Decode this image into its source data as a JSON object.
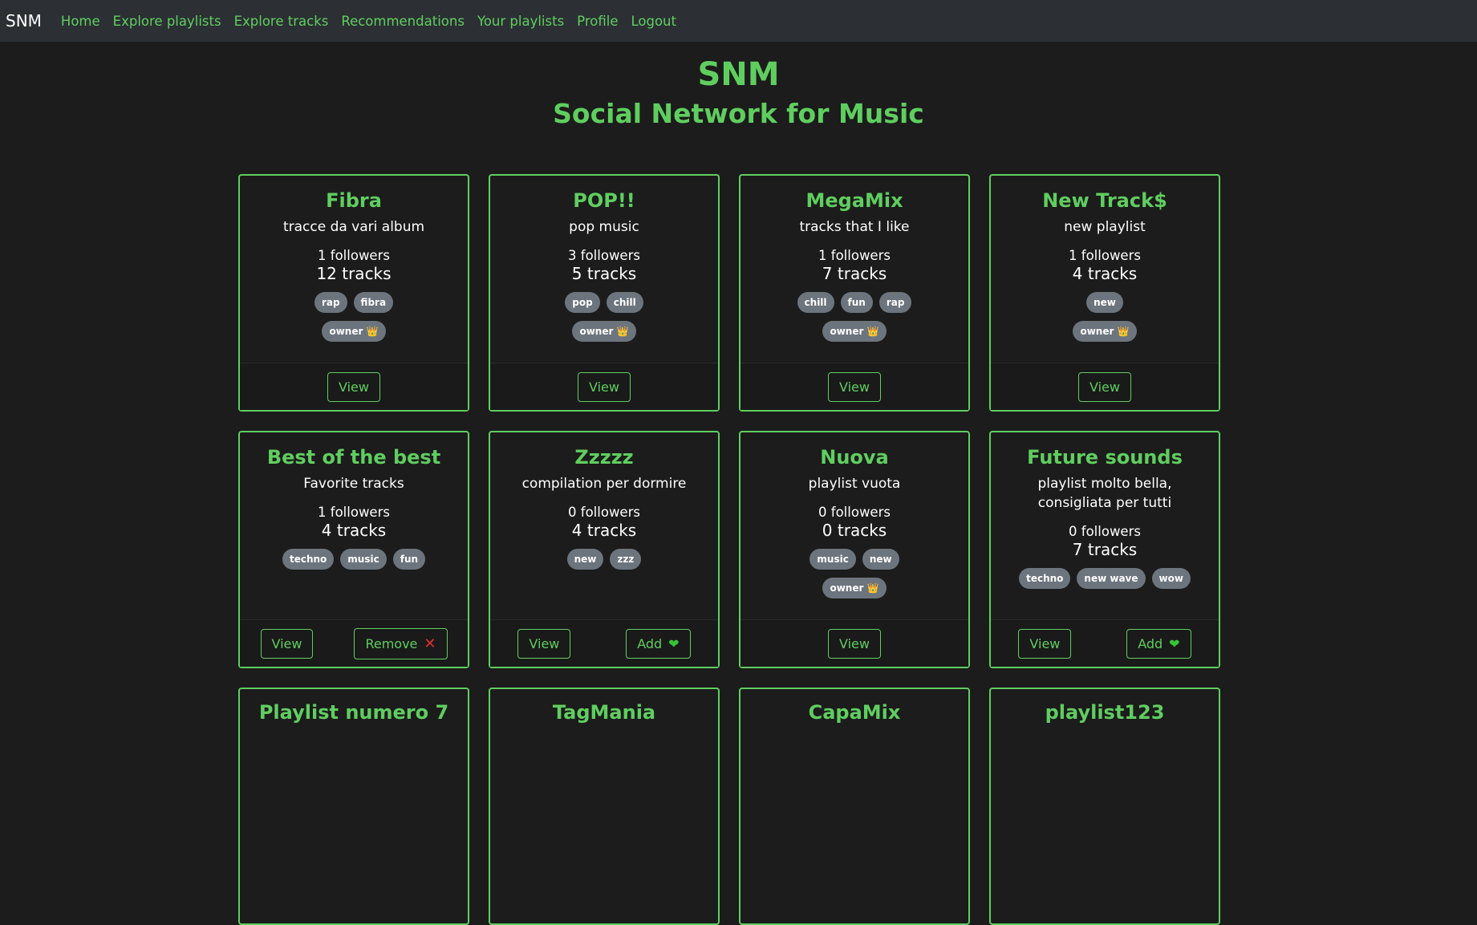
{
  "nav": {
    "brand": "SNM",
    "links": [
      "Home",
      "Explore playlists",
      "Explore tracks",
      "Recommendations",
      "Your playlists",
      "Profile",
      "Logout"
    ]
  },
  "hero": {
    "title": "SNM",
    "subtitle": "Social Network for Music"
  },
  "labels": {
    "view": "View",
    "add": "Add",
    "remove": "Remove",
    "owner": "owner 👑"
  },
  "playlists": [
    {
      "title": "Fibra",
      "description": "tracce da vari album",
      "followers": "1 followers",
      "tracks": "12 tracks",
      "tags": [
        "rap",
        "fibra"
      ]
    },
    {
      "title": "POP!!",
      "description": "pop music",
      "followers": "3 followers",
      "tracks": "5 tracks",
      "tags": [
        "pop",
        "chill"
      ]
    },
    {
      "title": "MegaMix",
      "description": "tracks that I like",
      "followers": "1 followers",
      "tracks": "7 tracks",
      "tags": [
        "chill",
        "fun",
        "rap"
      ]
    },
    {
      "title": "New Track$",
      "description": "new playlist",
      "followers": "1 followers",
      "tracks": "4 tracks",
      "tags": [
        "new"
      ]
    },
    {
      "title": "Best of the best",
      "description": "Favorite tracks",
      "followers": "1 followers",
      "tracks": "4 tracks",
      "tags": [
        "techno",
        "music",
        "fun"
      ]
    },
    {
      "title": "Zzzzz",
      "description": "compilation per dormire",
      "followers": "0 followers",
      "tracks": "4 tracks",
      "tags": [
        "new",
        "zzz"
      ]
    },
    {
      "title": "Nuova",
      "description": "playlist vuota",
      "followers": "0 followers",
      "tracks": "0 tracks",
      "tags": [
        "music",
        "new"
      ]
    },
    {
      "title": "Future sounds",
      "description": "playlist molto bella, consigliata per tutti",
      "followers": "0 followers",
      "tracks": "7 tracks",
      "tags": [
        "techno",
        "new wave",
        "wow"
      ]
    },
    {
      "title": "Playlist numero 7"
    },
    {
      "title": "TagMania"
    },
    {
      "title": "CapaMix"
    },
    {
      "title": "playlist123"
    }
  ]
}
